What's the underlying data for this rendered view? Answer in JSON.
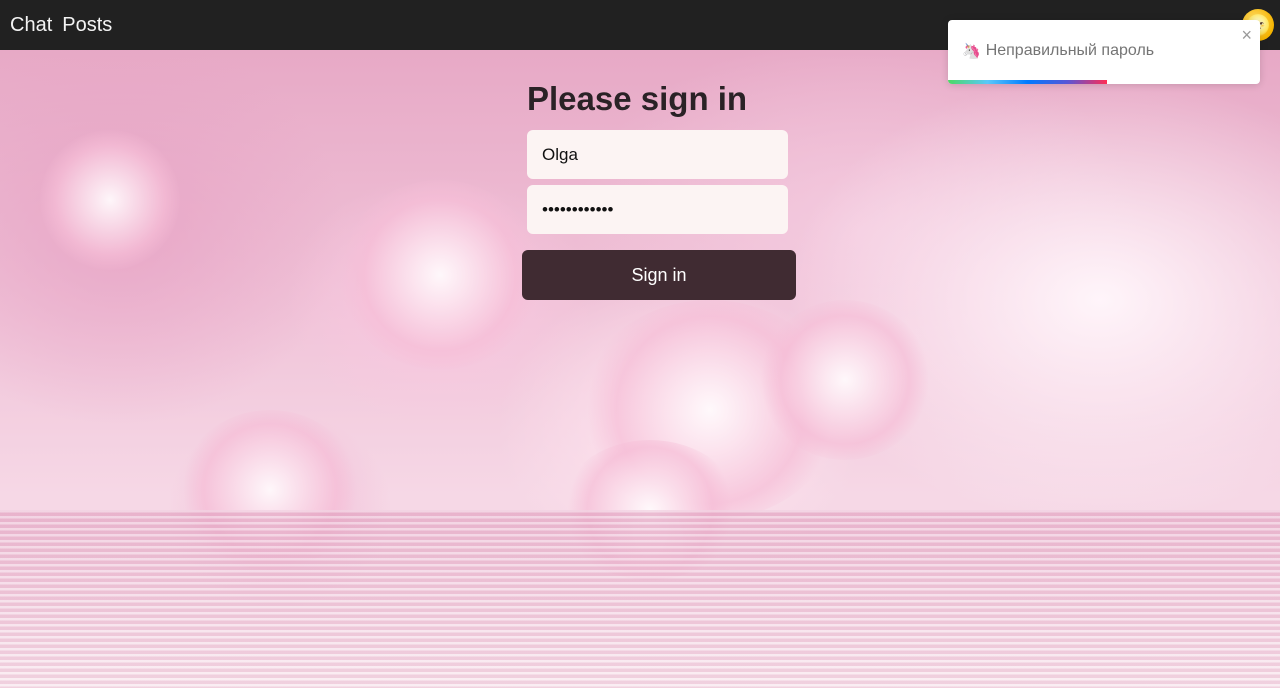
{
  "nav": {
    "links": [
      "Chat",
      "Posts"
    ],
    "avatar_glyph": "🌝"
  },
  "form": {
    "title": "Please sign in",
    "username_value": "Olga",
    "password_value": "••••••••••••",
    "submit_label": "Sign in"
  },
  "toast": {
    "icon": "🦄",
    "message": "Неправильный пароль",
    "close_glyph": "×",
    "progress": 0.51
  },
  "colors": {
    "navbar": "#212121",
    "button": "#402b32",
    "input_bg": "#fcf4f3"
  }
}
